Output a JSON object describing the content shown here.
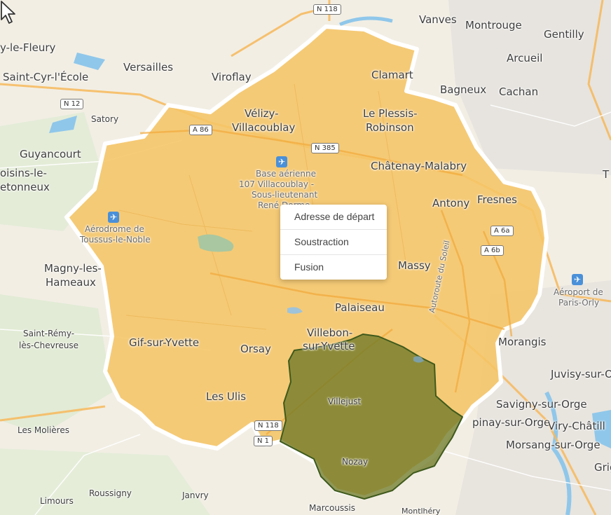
{
  "map": {
    "zone_color": "#f5c566",
    "subtraction_color": "#6f7a28",
    "border_color": "#ffffff",
    "places": {
      "vanves": "Vanves",
      "montrouge": "Montrouge",
      "gentilly": "Gentilly",
      "arcueil": "Arcueil",
      "bagneux": "Bagneux",
      "cachan": "Cachan",
      "clamart": "Clamart",
      "le_plessis": "Le Plessis-",
      "robinson": "Robinson",
      "velizy": "Vélizy-",
      "villacoublay": "Villacoublay",
      "versailles": "Versailles",
      "viroflay": "Viroflay",
      "saint_cyr": "Saint-Cyr-l'École",
      "fleury": "y-le-Fleury",
      "satory": "Satory",
      "guyancourt": "Guyancourt",
      "bois_le": "oisins-le-",
      "bretonneux": "etonneux",
      "chatenay": "Châtenay-Malabry",
      "antony": "Antony",
      "fresnes": "Fresnes",
      "massy": "Massy",
      "palaiseau": "Palaiseau",
      "villebon": "Villebon-",
      "sur_yvette": "sur-Yvette",
      "orsay": "Orsay",
      "gif": "Gif-sur-Yvette",
      "les_ulis": "Les Ulis",
      "magny": "Magny-les-",
      "hameaux": "Hameaux",
      "saint_remy": "Saint-Rémy-",
      "chevreuse": "lès-Chevreuse",
      "molieres": "Les Molières",
      "limours": "Limours",
      "roussigny": "Roussigny",
      "janvry": "Janvry",
      "marcoussis": "Marcoussis",
      "montlhery": "Montlhéry",
      "villejust": "Villejust",
      "nozay": "Nozay",
      "morangis": "Morangis",
      "juvisy": "Juvisy-sur-O",
      "savigny": "Savigny-sur-Orge",
      "epinay": "pinay-sur-Orge",
      "viry": "Viry-Châtill",
      "morsang": "Morsang-sur-Orge",
      "grig": "Grig",
      "base1": "Base aérienne",
      "base2": "107 Villacoublay -",
      "base3": "Sous-lieutenant",
      "base4": "René Dorme",
      "toussus1": "Aérodrome de",
      "toussus2": "Toussus-le-Noble",
      "orly1": "Aéroport de",
      "orly2": "Paris-Orly",
      "autoroute": "Autoroute du Soleil",
      "t": "T"
    },
    "roads": {
      "n118_top": "N 118",
      "n12": "N 12",
      "a86": "A 86",
      "n385": "N 385",
      "a6a": "A 6a",
      "a6b": "A 6b",
      "n118_bottom": "N 118",
      "n_c": "N 1"
    }
  },
  "context_menu": {
    "items": [
      "Adresse de départ",
      "Soustraction",
      "Fusion"
    ]
  }
}
